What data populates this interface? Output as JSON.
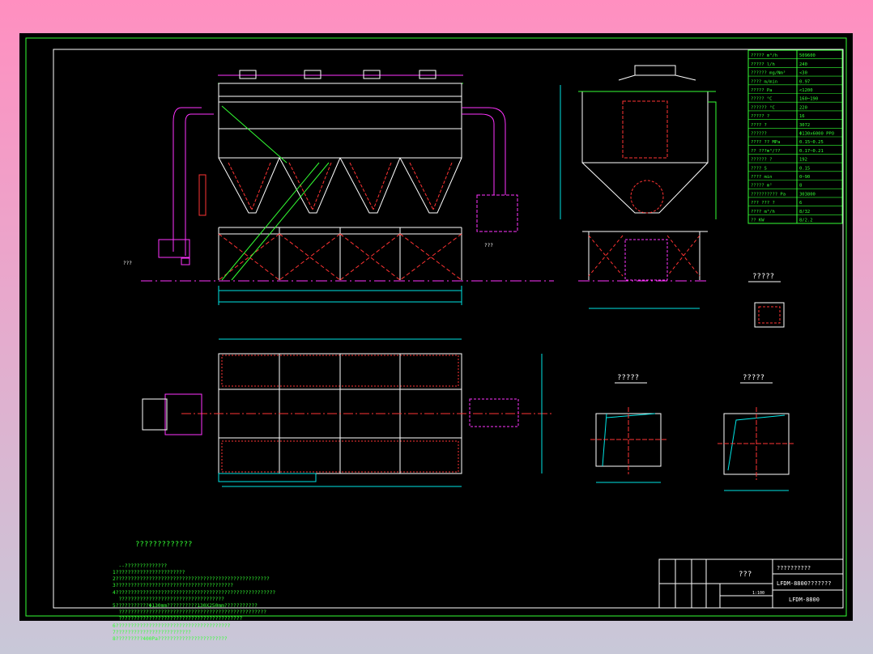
{
  "colors": {
    "frame": "#ffffff",
    "green": "#33ff33",
    "cyan": "#00e5e5",
    "red": "#ff3333",
    "magenta": "#ff33ff",
    "yellow": "#ffff44"
  },
  "spec_table": {
    "rows": [
      {
        "name": "?????",
        "unit": "m³/h",
        "value": "509600"
      },
      {
        "name": "?????",
        "unit": "l/h",
        "value": "240"
      },
      {
        "name": "??????",
        "unit": "mg/Nm³",
        "value": "<30"
      },
      {
        "name": "????",
        "unit": "m/min",
        "value": "0.97"
      },
      {
        "name": "?????",
        "unit": "Pa",
        "value": "<1200"
      },
      {
        "name": "?????",
        "unit": "°C",
        "value": "160~190"
      },
      {
        "name": "??????",
        "unit": "°C",
        "value": "220"
      },
      {
        "name": "?????",
        "unit": "?",
        "value": "16"
      },
      {
        "name": "????",
        "unit": "?",
        "value": "3072"
      },
      {
        "name": "??????",
        "unit": "",
        "value": "Φ130x6000 PPO"
      },
      {
        "name": "????",
        "unit": "?? MPa",
        "value": "0.15~0.25"
      },
      {
        "name": "??",
        "unit": "???m³/??",
        "value": "0.17~0.21"
      },
      {
        "name": "??????",
        "unit": "?",
        "value": "192"
      },
      {
        "name": "????",
        "unit": "S",
        "value": "0.15"
      },
      {
        "name": "????",
        "unit": "min",
        "value": "0~90"
      },
      {
        "name": "?????",
        "unit": "m²",
        "value": "8"
      },
      {
        "name": "??????????",
        "unit": "Pa",
        "value": "303800"
      },
      {
        "name": "??? ???",
        "unit": "?",
        "value": "6"
      },
      {
        "name": "????",
        "unit": "m³/h",
        "value": "8/32"
      },
      {
        "name": "??",
        "unit": "KW",
        "value": "8/2.2"
      }
    ]
  },
  "labels": {
    "outlet": "???",
    "inlet": "???",
    "detail_small": "?????",
    "detail_a": "?????",
    "detail_b": "?????"
  },
  "notes": {
    "title": "?????????????",
    "lines": [
      "  --??????????????",
      "1???????????????????????",
      "2???????????????????????????????????????????????????",
      "3???????????????????????????????????????",
      "4?????????????????????????????????????????????????????",
      "  ???????????????????????????????????",
      "5???????????Φ130mm??????????130X250mm???????????",
      "  ?????????????????????????????????????????????????",
      "  ?????????????????????????????????????????",
      "6??????????????????????????????????????",
      "7?????????????????????????",
      "8?????????400Pa???????????????????????"
    ]
  },
  "title_block": {
    "drawing_title": "???",
    "company": "??????????",
    "model_desc": "LFDM-8800???????",
    "model_code": "LFDM-8800",
    "scale": "1:100"
  }
}
